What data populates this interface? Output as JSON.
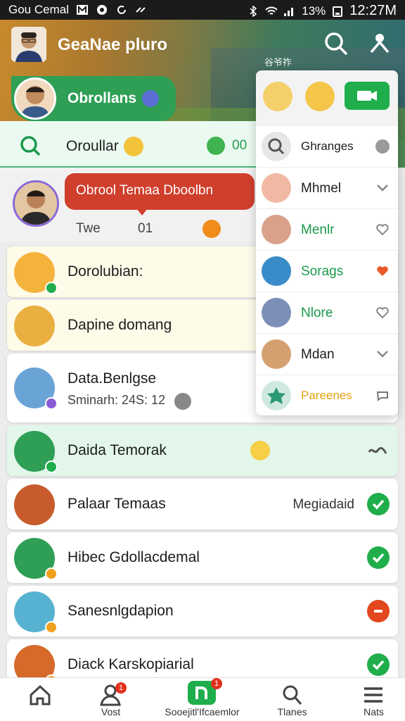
{
  "status_bar": {
    "carrier": "Gou Cemal",
    "battery": "13%",
    "time": "12:27M"
  },
  "app_bar": {
    "title": "GeaNae pluro",
    "subtitle_label": "谷爷祚"
  },
  "current_user": {
    "name": "Obrollans"
  },
  "search_row": {
    "label": "Oroullar",
    "count": "00"
  },
  "featured_chat": {
    "title": "Obrool Temaa Dboolbn",
    "sub_label": "Twe",
    "sub_value": "01"
  },
  "chats": [
    {
      "name": "Dorolubian:",
      "meta": "",
      "right": "",
      "status": "none"
    },
    {
      "name": "Dapine domang",
      "meta": "",
      "right": "",
      "status": "none"
    },
    {
      "name": "Data.Benlgse",
      "meta": "Sminarh: 24S: 12",
      "right": "",
      "status": "none"
    },
    {
      "name": "Daida Temorak",
      "meta": "",
      "right": "",
      "status": "highlight"
    },
    {
      "name": "Palaar Temaas",
      "meta": "",
      "right": "Megiadaid",
      "status": "check"
    },
    {
      "name": "Hibec Gdollacdemal",
      "meta": "",
      "right": "",
      "status": "check"
    },
    {
      "name": "Sanesnlgdapion",
      "meta": "",
      "right": "",
      "status": "red"
    },
    {
      "name": "Diack Karskopiarial",
      "meta": "",
      "right": "",
      "status": "check"
    }
  ],
  "dropdown": {
    "items": [
      {
        "label": "Ghranges",
        "color": "#444444",
        "trail": "toggle"
      },
      {
        "label": "Mhmel",
        "color": "#333333",
        "trail": "chevron"
      },
      {
        "label": "Menlr",
        "color": "#1b9a4a",
        "trail": "heart-outline"
      },
      {
        "label": "Sorags",
        "color": "#1b9a4a",
        "trail": "heart-filled"
      },
      {
        "label": "Nlore",
        "color": "#1b9a4a",
        "trail": "heart-outline"
      },
      {
        "label": "Mdan",
        "color": "#333333",
        "trail": "chevron"
      },
      {
        "label": "Pareenes",
        "color": "#e4a112",
        "trail": "chat-icon"
      }
    ]
  },
  "bottom_nav": {
    "items": [
      {
        "label": "",
        "icon": "home-icon"
      },
      {
        "label": "Vost",
        "icon": "people-icon",
        "badge": "1"
      },
      {
        "label": "Sooejitl'Ifcaemlor",
        "icon": "app-icon",
        "badge": "1"
      },
      {
        "label": "Tlanes",
        "icon": "search-icon"
      },
      {
        "label": "Nats",
        "icon": "menu-icon"
      }
    ]
  },
  "colors": {
    "primary_green": "#1fae4b",
    "accent_red": "#d03e2c",
    "status_bar": "#1b1b1b"
  }
}
